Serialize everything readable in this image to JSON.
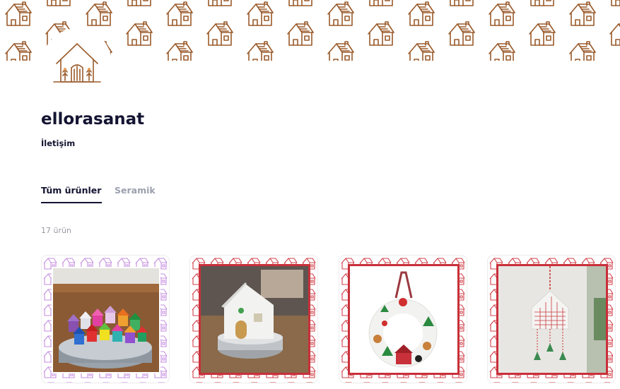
{
  "shop": {
    "name": "ellorasanat",
    "contact_label": "İletişim"
  },
  "tabs": [
    {
      "label": "Tüm ürünler",
      "active": true
    },
    {
      "label": "Seramik",
      "active": false
    }
  ],
  "product_count": "17 ürün",
  "colors": {
    "text_primary": "#141432",
    "text_muted": "#9aa0ad",
    "banner_house": "#9a5a2a",
    "pattern_purple": "#c58ee0",
    "pattern_red": "#d0404a"
  },
  "products": [
    {
      "pattern": "purple",
      "photo": "miniature ceramic houses on turntable"
    },
    {
      "pattern": "red",
      "photo": "white ceramic house lantern"
    },
    {
      "pattern": "red",
      "photo": "ceramic christmas wreath"
    },
    {
      "pattern": "red",
      "photo": "ceramic house wall hanging"
    }
  ],
  "icons": {
    "logo": "house-logo-icon",
    "banner": "house-pattern"
  }
}
